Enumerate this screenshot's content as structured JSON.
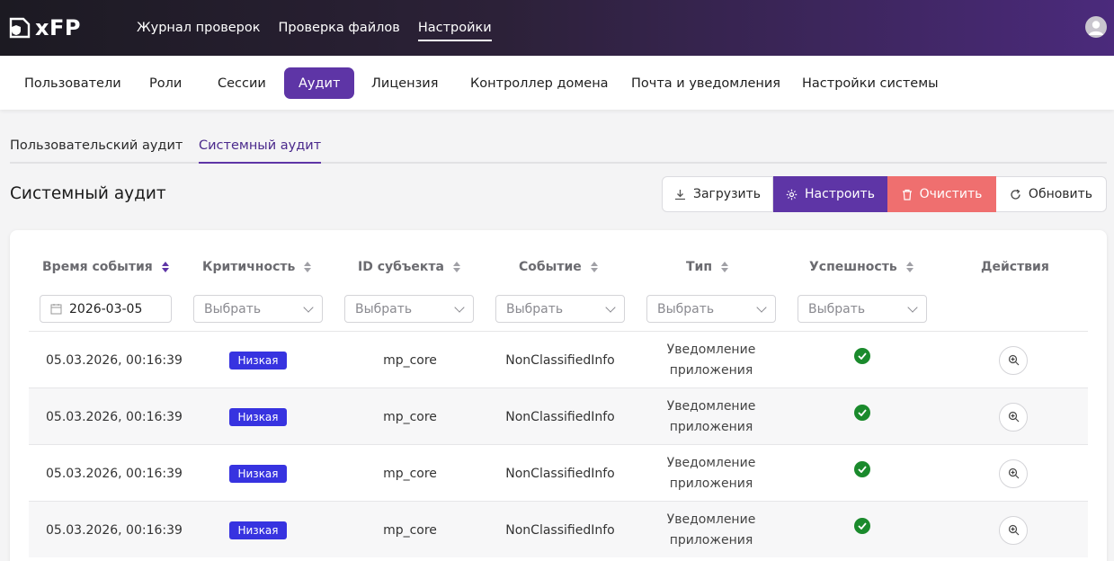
{
  "app": {
    "logo_text": "xFP"
  },
  "topnav": [
    {
      "label": "Журнал проверок"
    },
    {
      "label": "Проверка файлов"
    },
    {
      "label": "Настройки",
      "active": true
    }
  ],
  "subnav": [
    {
      "label": "Пользователи"
    },
    {
      "label": "Роли"
    },
    {
      "label": "Сессии"
    },
    {
      "label": "Аудит",
      "active": true
    },
    {
      "label": "Лицензия"
    },
    {
      "label": "Контроллер домена"
    },
    {
      "label": "Почта и уведомления"
    },
    {
      "label": "Настройки системы"
    }
  ],
  "audit_tabs": [
    {
      "label": "Пользовательский аудит"
    },
    {
      "label": "Системный аудит",
      "active": true
    }
  ],
  "page_title": "Системный аудит",
  "actions": {
    "download": "Загрузить",
    "configure": "Настроить",
    "clear": "Очистить",
    "refresh": "Обновить"
  },
  "table": {
    "columns": [
      {
        "label": "Время события",
        "sortable": true,
        "sort_active": true
      },
      {
        "label": "Критичность",
        "sortable": true
      },
      {
        "label": "ID субъекта",
        "sortable": true
      },
      {
        "label": "Событие",
        "sortable": true
      },
      {
        "label": "Тип",
        "sortable": true
      },
      {
        "label": "Успешность",
        "sortable": true
      },
      {
        "label": "Действия",
        "sortable": false
      }
    ],
    "filters": {
      "date_value": "2026-03-05",
      "select_placeholder": "Выбрать"
    },
    "rows": [
      {
        "time": "05.03.2026, 00:16:39",
        "severity": "Низкая",
        "subject": "mp_core",
        "event": "NonClassifiedInfo",
        "type_line1": "Уведомление",
        "type_line2": "приложения",
        "success": true
      },
      {
        "time": "05.03.2026, 00:16:39",
        "severity": "Низкая",
        "subject": "mp_core",
        "event": "NonClassifiedInfo",
        "type_line1": "Уведомление",
        "type_line2": "приложения",
        "success": true
      },
      {
        "time": "05.03.2026, 00:16:39",
        "severity": "Низкая",
        "subject": "mp_core",
        "event": "NonClassifiedInfo",
        "type_line1": "Уведомление",
        "type_line2": "приложения",
        "success": true
      },
      {
        "time": "05.03.2026, 00:16:39",
        "severity": "Низкая",
        "subject": "mp_core",
        "event": "NonClassifiedInfo",
        "type_line1": "Уведомление",
        "type_line2": "приложения",
        "success": true
      }
    ]
  },
  "colors": {
    "accent": "#5e35a6",
    "danger": "#ef6f6f",
    "badge": "#3733e0",
    "success": "#1a8a2c"
  }
}
